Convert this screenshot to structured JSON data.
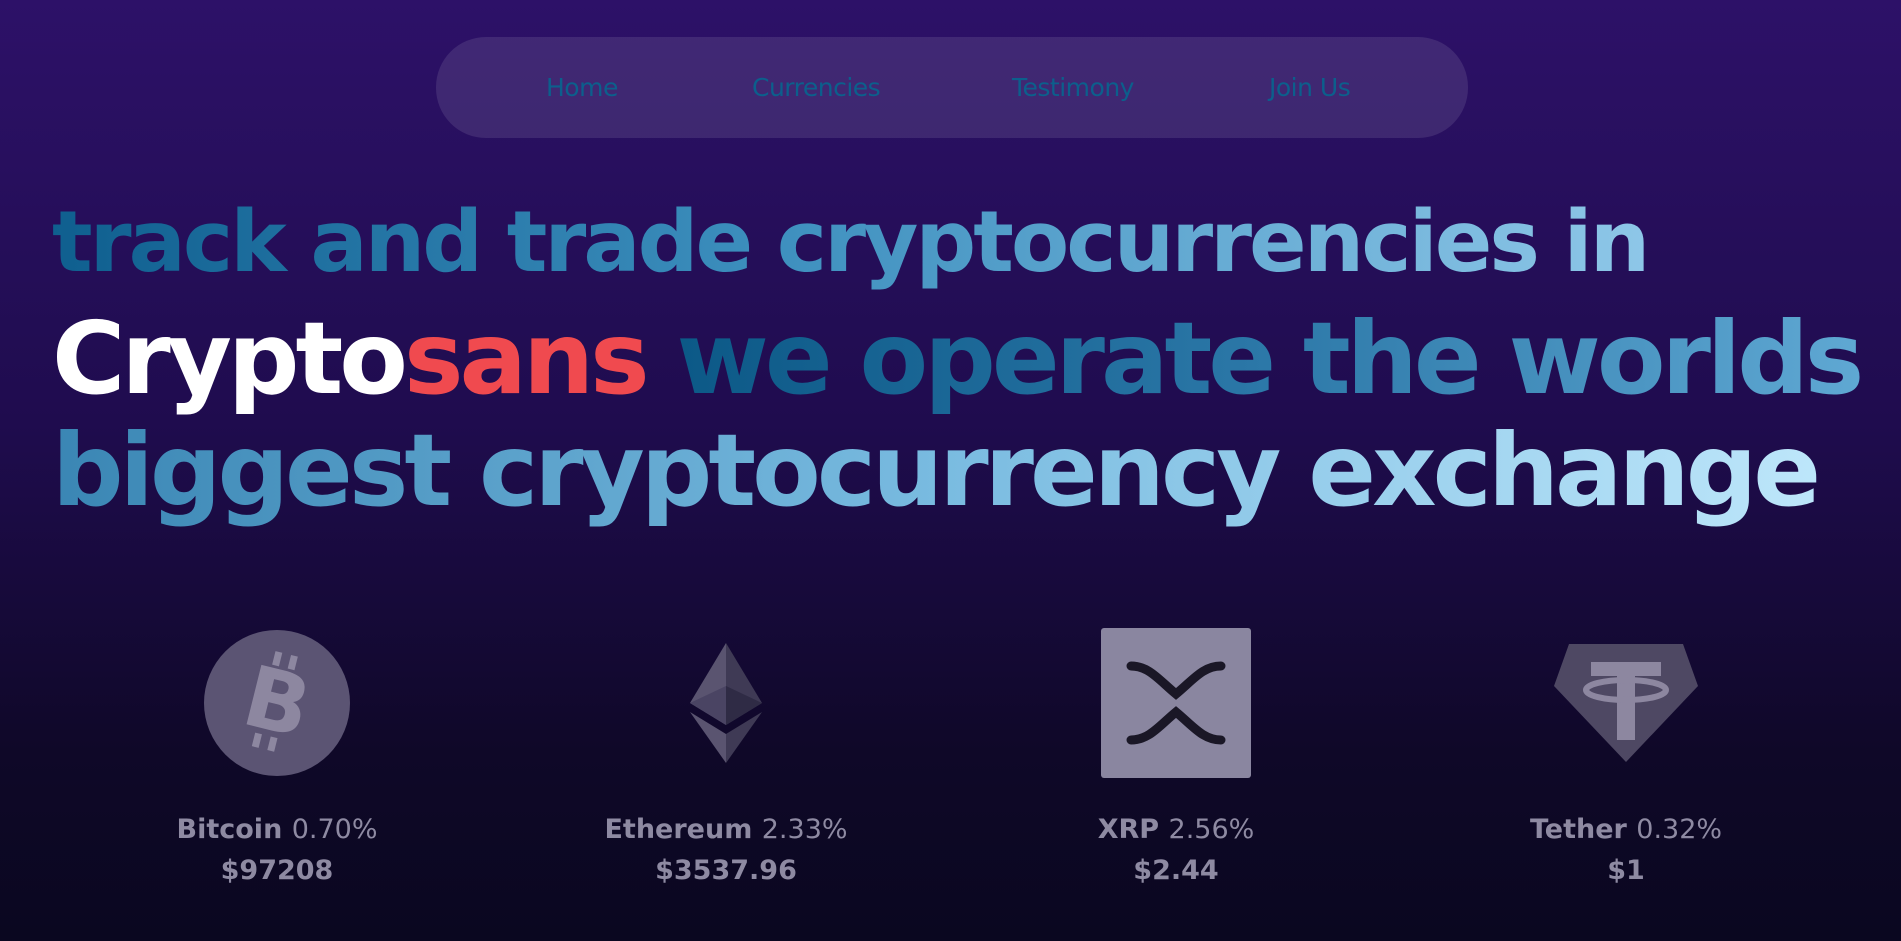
{
  "nav": {
    "items": [
      {
        "label": "Home"
      },
      {
        "label": "Currencies"
      },
      {
        "label": "Testimony"
      },
      {
        "label": "Join Us"
      }
    ]
  },
  "hero": {
    "line1": "track and trade cryptocurrencies in",
    "brand_part1": "Crypto",
    "brand_part2": "sans",
    "line2_rest": " we operate the worlds",
    "line3": "biggest cryptocurrency exchange",
    "colors": {
      "brand_white": "#ffffff",
      "brand_red": "#f04a4f",
      "accent_blue": "#0c5f8c"
    }
  },
  "coins": [
    {
      "name": "Bitcoin",
      "change": "0.70%",
      "price": "$97208",
      "icon": "bitcoin-icon"
    },
    {
      "name": "Ethereum",
      "change": "2.33%",
      "price": "$3537.96",
      "icon": "ethereum-icon"
    },
    {
      "name": "XRP",
      "change": "2.56%",
      "price": "$2.44",
      "icon": "xrp-icon"
    },
    {
      "name": "Tether",
      "change": "0.32%",
      "price": "$1",
      "icon": "tether-icon"
    }
  ]
}
